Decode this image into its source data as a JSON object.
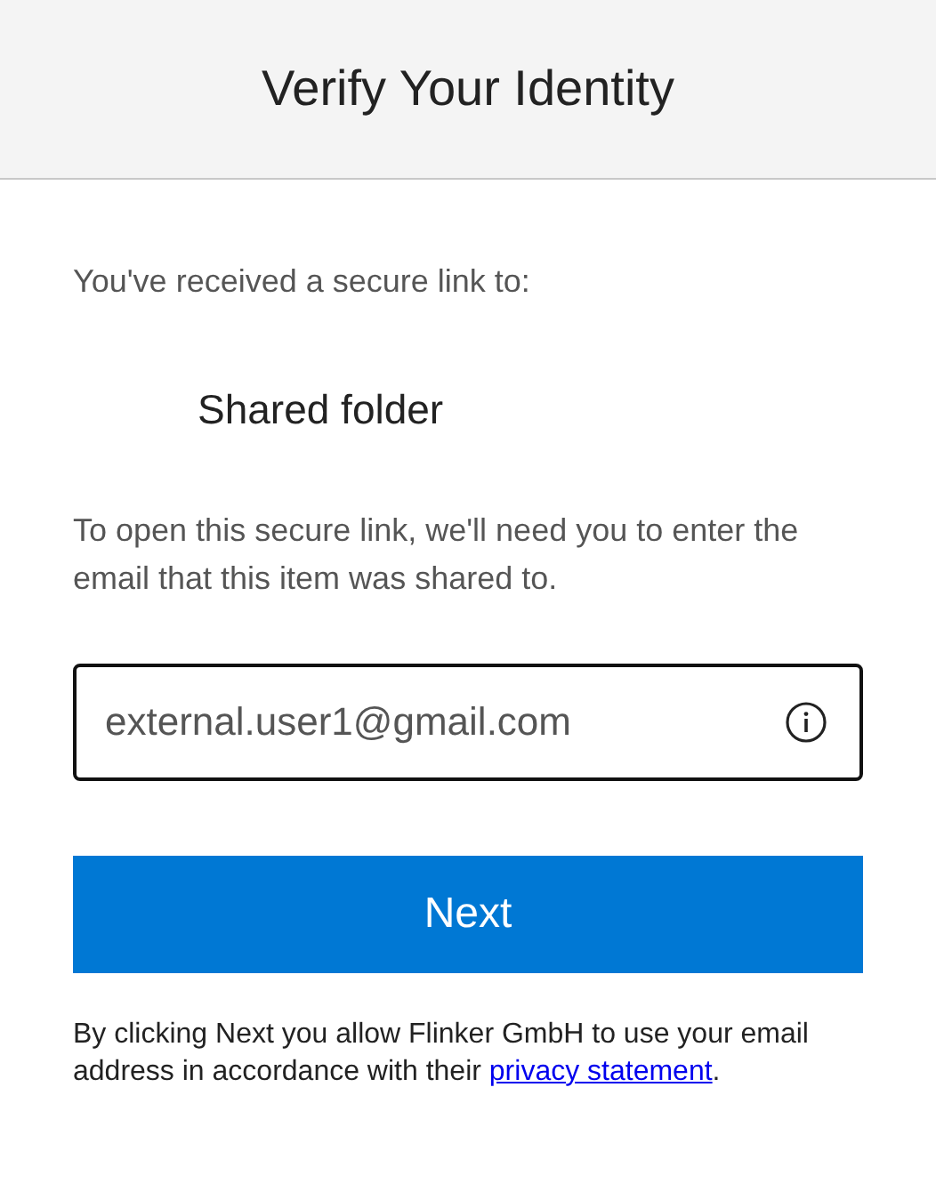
{
  "header": {
    "title": "Verify Your Identity"
  },
  "intro": "You've received a secure link to:",
  "item_name": "Shared folder",
  "instructions": "To open this secure link, we'll need you to enter the email that this item was shared to.",
  "email_field": {
    "value": "external.user1@gmail.com"
  },
  "buttons": [
    "Next"
  ],
  "footer": {
    "text": "By clicking Next you allow Flinker GmbH to use your email address in accordance with their",
    "link": "privacy statement",
    "end": "."
  }
}
